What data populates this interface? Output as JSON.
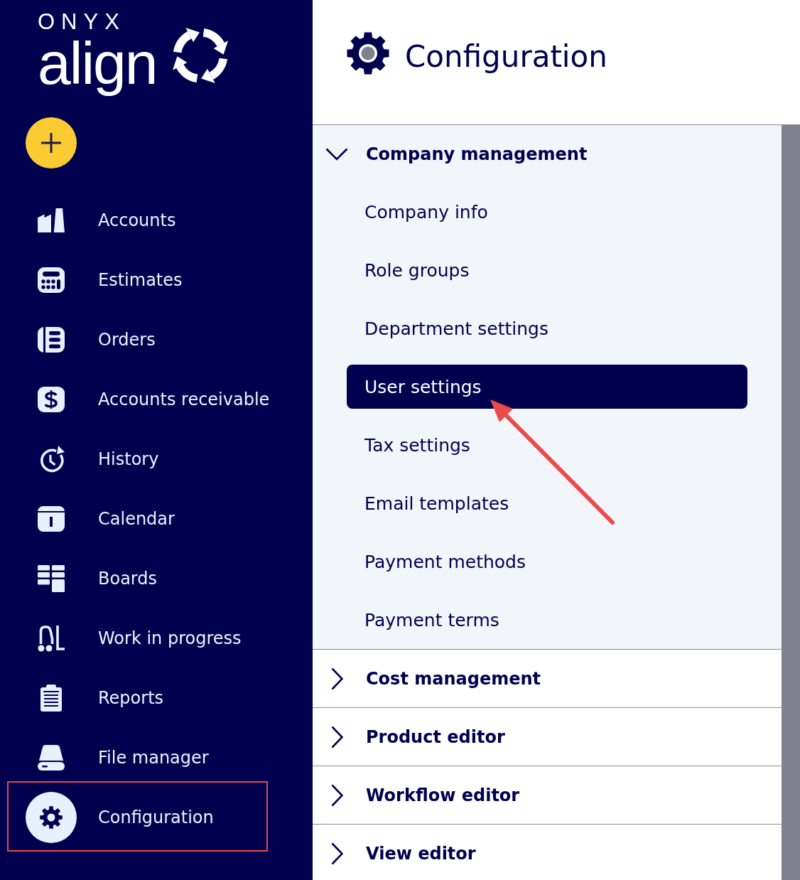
{
  "sidebar": {
    "logo": {
      "brand": "ONYX",
      "product": "align"
    },
    "nav": [
      {
        "label": "Accounts",
        "selected": false,
        "outlined": false
      },
      {
        "label": "Estimates",
        "selected": false,
        "outlined": false
      },
      {
        "label": "Orders",
        "selected": false,
        "outlined": false
      },
      {
        "label": "Accounts receivable",
        "selected": false,
        "outlined": false
      },
      {
        "label": "History",
        "selected": false,
        "outlined": false
      },
      {
        "label": "Calendar",
        "selected": false,
        "outlined": false
      },
      {
        "label": "Boards",
        "selected": false,
        "outlined": false
      },
      {
        "label": "Work in progress",
        "selected": false,
        "outlined": false
      },
      {
        "label": "Reports",
        "selected": false,
        "outlined": false
      },
      {
        "label": "File manager",
        "selected": false,
        "outlined": false
      },
      {
        "label": "Configuration",
        "selected": true,
        "outlined": true
      }
    ]
  },
  "page": {
    "title": "Configuration"
  },
  "sections": [
    {
      "title": "Company management",
      "expanded": true,
      "items": [
        {
          "label": "Company info",
          "selected": false,
          "arrow": false
        },
        {
          "label": "Role groups",
          "selected": false,
          "arrow": false
        },
        {
          "label": "Department settings",
          "selected": false,
          "arrow": false
        },
        {
          "label": "User settings",
          "selected": true,
          "arrow": true
        },
        {
          "label": "Tax settings",
          "selected": false,
          "arrow": false
        },
        {
          "label": "Email templates",
          "selected": false,
          "arrow": false
        },
        {
          "label": "Payment methods",
          "selected": false,
          "arrow": false
        },
        {
          "label": "Payment terms",
          "selected": false,
          "arrow": false
        }
      ]
    },
    {
      "title": "Cost management",
      "expanded": false
    },
    {
      "title": "Product editor",
      "expanded": false
    },
    {
      "title": "Workflow editor",
      "expanded": false
    },
    {
      "title": "View editor",
      "expanded": false
    }
  ]
}
